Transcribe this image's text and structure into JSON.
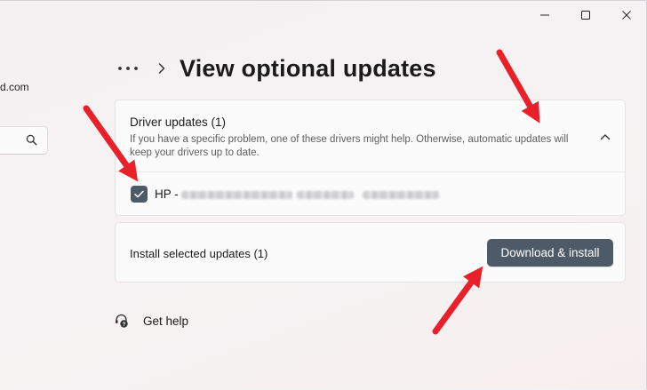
{
  "window": {
    "minimize_icon": "minimize-icon",
    "maximize_icon": "maximize-icon",
    "close_icon": "close-icon"
  },
  "sidebar": {
    "account_email_fragment": "d.com",
    "search_icon": "search-icon"
  },
  "breadcrumb": {
    "more_icon": "more-horizontal-icon",
    "separator_icon": "chevron-right-icon",
    "title": "View optional updates"
  },
  "driver_updates": {
    "title": "Driver updates (1)",
    "description": "If you have a specific problem, one of these drivers might help. Otherwise, automatic updates will keep your drivers up to date.",
    "expanded": true,
    "items": [
      {
        "checked": true,
        "name": "HP - "
      }
    ]
  },
  "install": {
    "label": "Install selected updates (1)",
    "button_label": "Download & install"
  },
  "help": {
    "label": "Get help",
    "icon": "get-help-icon"
  },
  "colors": {
    "accent": "#4d5b68",
    "annotation_arrow": "#e8202a",
    "card_background": "#fbfbfb"
  }
}
